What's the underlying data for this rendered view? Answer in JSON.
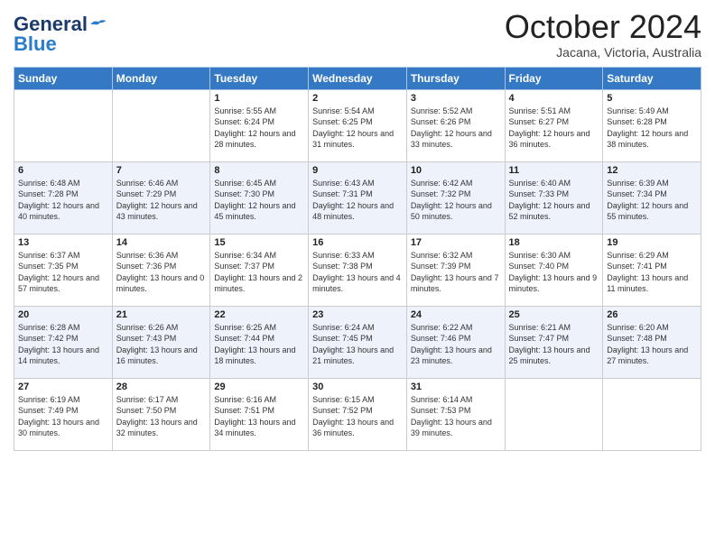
{
  "logo": {
    "general": "General",
    "blue": "Blue"
  },
  "title": "October 2024",
  "location": "Jacana, Victoria, Australia",
  "days_of_week": [
    "Sunday",
    "Monday",
    "Tuesday",
    "Wednesday",
    "Thursday",
    "Friday",
    "Saturday"
  ],
  "weeks": [
    [
      {
        "day": "",
        "info": ""
      },
      {
        "day": "",
        "info": ""
      },
      {
        "day": "1",
        "info": "Sunrise: 5:55 AM\nSunset: 6:24 PM\nDaylight: 12 hours and 28 minutes."
      },
      {
        "day": "2",
        "info": "Sunrise: 5:54 AM\nSunset: 6:25 PM\nDaylight: 12 hours and 31 minutes."
      },
      {
        "day": "3",
        "info": "Sunrise: 5:52 AM\nSunset: 6:26 PM\nDaylight: 12 hours and 33 minutes."
      },
      {
        "day": "4",
        "info": "Sunrise: 5:51 AM\nSunset: 6:27 PM\nDaylight: 12 hours and 36 minutes."
      },
      {
        "day": "5",
        "info": "Sunrise: 5:49 AM\nSunset: 6:28 PM\nDaylight: 12 hours and 38 minutes."
      }
    ],
    [
      {
        "day": "6",
        "info": "Sunrise: 6:48 AM\nSunset: 7:28 PM\nDaylight: 12 hours and 40 minutes."
      },
      {
        "day": "7",
        "info": "Sunrise: 6:46 AM\nSunset: 7:29 PM\nDaylight: 12 hours and 43 minutes."
      },
      {
        "day": "8",
        "info": "Sunrise: 6:45 AM\nSunset: 7:30 PM\nDaylight: 12 hours and 45 minutes."
      },
      {
        "day": "9",
        "info": "Sunrise: 6:43 AM\nSunset: 7:31 PM\nDaylight: 12 hours and 48 minutes."
      },
      {
        "day": "10",
        "info": "Sunrise: 6:42 AM\nSunset: 7:32 PM\nDaylight: 12 hours and 50 minutes."
      },
      {
        "day": "11",
        "info": "Sunrise: 6:40 AM\nSunset: 7:33 PM\nDaylight: 12 hours and 52 minutes."
      },
      {
        "day": "12",
        "info": "Sunrise: 6:39 AM\nSunset: 7:34 PM\nDaylight: 12 hours and 55 minutes."
      }
    ],
    [
      {
        "day": "13",
        "info": "Sunrise: 6:37 AM\nSunset: 7:35 PM\nDaylight: 12 hours and 57 minutes."
      },
      {
        "day": "14",
        "info": "Sunrise: 6:36 AM\nSunset: 7:36 PM\nDaylight: 13 hours and 0 minutes."
      },
      {
        "day": "15",
        "info": "Sunrise: 6:34 AM\nSunset: 7:37 PM\nDaylight: 13 hours and 2 minutes."
      },
      {
        "day": "16",
        "info": "Sunrise: 6:33 AM\nSunset: 7:38 PM\nDaylight: 13 hours and 4 minutes."
      },
      {
        "day": "17",
        "info": "Sunrise: 6:32 AM\nSunset: 7:39 PM\nDaylight: 13 hours and 7 minutes."
      },
      {
        "day": "18",
        "info": "Sunrise: 6:30 AM\nSunset: 7:40 PM\nDaylight: 13 hours and 9 minutes."
      },
      {
        "day": "19",
        "info": "Sunrise: 6:29 AM\nSunset: 7:41 PM\nDaylight: 13 hours and 11 minutes."
      }
    ],
    [
      {
        "day": "20",
        "info": "Sunrise: 6:28 AM\nSunset: 7:42 PM\nDaylight: 13 hours and 14 minutes."
      },
      {
        "day": "21",
        "info": "Sunrise: 6:26 AM\nSunset: 7:43 PM\nDaylight: 13 hours and 16 minutes."
      },
      {
        "day": "22",
        "info": "Sunrise: 6:25 AM\nSunset: 7:44 PM\nDaylight: 13 hours and 18 minutes."
      },
      {
        "day": "23",
        "info": "Sunrise: 6:24 AM\nSunset: 7:45 PM\nDaylight: 13 hours and 21 minutes."
      },
      {
        "day": "24",
        "info": "Sunrise: 6:22 AM\nSunset: 7:46 PM\nDaylight: 13 hours and 23 minutes."
      },
      {
        "day": "25",
        "info": "Sunrise: 6:21 AM\nSunset: 7:47 PM\nDaylight: 13 hours and 25 minutes."
      },
      {
        "day": "26",
        "info": "Sunrise: 6:20 AM\nSunset: 7:48 PM\nDaylight: 13 hours and 27 minutes."
      }
    ],
    [
      {
        "day": "27",
        "info": "Sunrise: 6:19 AM\nSunset: 7:49 PM\nDaylight: 13 hours and 30 minutes."
      },
      {
        "day": "28",
        "info": "Sunrise: 6:17 AM\nSunset: 7:50 PM\nDaylight: 13 hours and 32 minutes."
      },
      {
        "day": "29",
        "info": "Sunrise: 6:16 AM\nSunset: 7:51 PM\nDaylight: 13 hours and 34 minutes."
      },
      {
        "day": "30",
        "info": "Sunrise: 6:15 AM\nSunset: 7:52 PM\nDaylight: 13 hours and 36 minutes."
      },
      {
        "day": "31",
        "info": "Sunrise: 6:14 AM\nSunset: 7:53 PM\nDaylight: 13 hours and 39 minutes."
      },
      {
        "day": "",
        "info": ""
      },
      {
        "day": "",
        "info": ""
      }
    ]
  ]
}
